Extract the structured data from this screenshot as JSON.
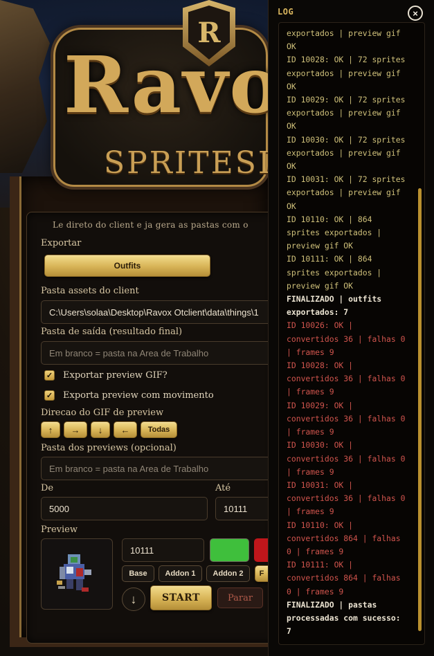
{
  "app": {
    "logo_letter": "R",
    "logo_title": "Ravox",
    "logo_subtitle": "SPRITESI"
  },
  "main": {
    "intro": "Le direto do client e ja gera as pastas com o",
    "export_label": "Exportar",
    "export_value": "Outfits",
    "assets_label": "Pasta assets do client",
    "assets_value": "C:\\Users\\solaa\\Desktop\\Ravox Otclient\\data\\things\\1",
    "output_label": "Pasta de saída (resultado final)",
    "output_placeholder": "Em branco = pasta na Area de Trabalho",
    "gif_check_label": "Exportar preview GIF?",
    "gif_check_checked": true,
    "motion_check_label": "Exporta preview com movimento",
    "motion_check_checked": true,
    "direction_label": "Direcao do GIF de preview",
    "directions": [
      "↑",
      "→",
      "↓",
      "←",
      "Todas"
    ],
    "preview_folder_label": "Pasta dos previews (opcional)",
    "preview_folder_placeholder": "Em branco = pasta na Area de Trabalho",
    "from_label": "De",
    "from_value": "5000",
    "to_label": "Até",
    "to_value": "10111",
    "preview_label": "Preview",
    "preview_id_value": "10111",
    "addons": [
      "Base",
      "Addon 1",
      "Addon 2",
      "F"
    ],
    "start_label": "START",
    "stop_label": "Parar",
    "down_icon": "↓",
    "colors": {
      "swatch_green": "#3fbf3c",
      "swatch_red": "#c0161b",
      "accent_gold": "#d7b356"
    }
  },
  "log": {
    "title": "LOG",
    "close_icon": "×",
    "lines": [
      {
        "type": "ok",
        "text": "exportados | preview gif"
      },
      {
        "type": "ok",
        "text": "OK"
      },
      {
        "type": "ok",
        "text": "ID 10028: OK | 72 sprites"
      },
      {
        "type": "ok",
        "text": "exportados | preview gif"
      },
      {
        "type": "ok",
        "text": "OK"
      },
      {
        "type": "ok",
        "text": "ID 10029: OK | 72 sprites"
      },
      {
        "type": "ok",
        "text": "exportados | preview gif"
      },
      {
        "type": "ok",
        "text": "OK"
      },
      {
        "type": "ok",
        "text": "ID 10030: OK | 72 sprites"
      },
      {
        "type": "ok",
        "text": "exportados | preview gif"
      },
      {
        "type": "ok",
        "text": "OK"
      },
      {
        "type": "ok",
        "text": "ID 10031: OK | 72 sprites"
      },
      {
        "type": "ok",
        "text": "exportados | preview gif"
      },
      {
        "type": "ok",
        "text": "OK"
      },
      {
        "type": "ok",
        "text": "ID 10110: OK | 864"
      },
      {
        "type": "ok",
        "text": "sprites exportados |"
      },
      {
        "type": "ok",
        "text": "preview gif OK"
      },
      {
        "type": "ok",
        "text": "ID 10111: OK | 864"
      },
      {
        "type": "ok",
        "text": "sprites exportados |"
      },
      {
        "type": "ok",
        "text": "preview gif OK"
      },
      {
        "type": "fin",
        "text": "FINALIZADO | outfits"
      },
      {
        "type": "fin",
        "text": "exportados: 7"
      },
      {
        "type": "err",
        "text": "ID 10026: OK |"
      },
      {
        "type": "err",
        "text": "convertidos 36 | falhas 0"
      },
      {
        "type": "err",
        "text": "| frames 9"
      },
      {
        "type": "err",
        "text": "ID 10028: OK |"
      },
      {
        "type": "err",
        "text": "convertidos 36 | falhas 0"
      },
      {
        "type": "err",
        "text": "| frames 9"
      },
      {
        "type": "err",
        "text": "ID 10029: OK |"
      },
      {
        "type": "err",
        "text": "convertidos 36 | falhas 0"
      },
      {
        "type": "err",
        "text": "| frames 9"
      },
      {
        "type": "err",
        "text": "ID 10030: OK |"
      },
      {
        "type": "err",
        "text": "convertidos 36 | falhas 0"
      },
      {
        "type": "err",
        "text": "| frames 9"
      },
      {
        "type": "err",
        "text": "ID 10031: OK |"
      },
      {
        "type": "err",
        "text": "convertidos 36 | falhas 0"
      },
      {
        "type": "err",
        "text": "| frames 9"
      },
      {
        "type": "err",
        "text": "ID 10110: OK |"
      },
      {
        "type": "err",
        "text": "convertidos 864 | falhas"
      },
      {
        "type": "err",
        "text": "0 | frames 9"
      },
      {
        "type": "err",
        "text": "ID 10111: OK |"
      },
      {
        "type": "err",
        "text": "convertidos 864 | falhas"
      },
      {
        "type": "err",
        "text": "0 | frames 9"
      },
      {
        "type": "fin",
        "text": "FINALIZADO | pastas"
      },
      {
        "type": "fin",
        "text": "processadas com sucesso:"
      },
      {
        "type": "fin",
        "text": "7"
      }
    ]
  }
}
